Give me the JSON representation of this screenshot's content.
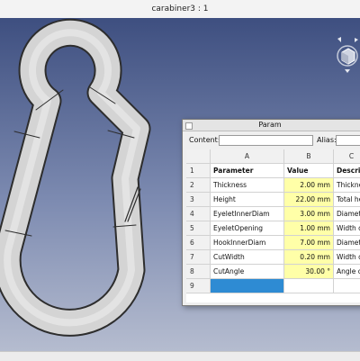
{
  "window": {
    "title": "carabiner3 : 1"
  },
  "param_window": {
    "title": "Param",
    "content_label": "Content:",
    "alias_label": "Alias:",
    "content_value": "",
    "alias_value": ""
  },
  "sheet": {
    "columns": [
      "A",
      "B",
      "C"
    ],
    "row_numbers": [
      "1",
      "2",
      "3",
      "4",
      "5",
      "6",
      "7",
      "8",
      "9"
    ],
    "rows": [
      [
        "Parameter",
        "Value",
        "Descri"
      ],
      [
        "Thickness",
        "2.00 mm",
        "Thicknes"
      ],
      [
        "Height",
        "22.00 mm",
        "Total hei"
      ],
      [
        "EyeletInnerDiam",
        "3.00 mm",
        "Diamete"
      ],
      [
        "EyeletOpening",
        "1.00 mm",
        "Width of"
      ],
      [
        "HookInnerDiam",
        "7.00 mm",
        "Diamete"
      ],
      [
        "CutWidth",
        "0.20 mm",
        "Width of"
      ],
      [
        "CutAngle",
        "30.00 °",
        "Angle of"
      ],
      [
        "",
        "",
        ""
      ]
    ]
  },
  "colors": {
    "viewport_top": "#3e4f80",
    "viewport_bottom": "#b5bccf",
    "value_cell": "#ffffa8",
    "selected_cell": "#2e8bd3",
    "model": "#d4d4d4"
  },
  "icons": [
    "navigation-cube-icon",
    "window-icon"
  ]
}
